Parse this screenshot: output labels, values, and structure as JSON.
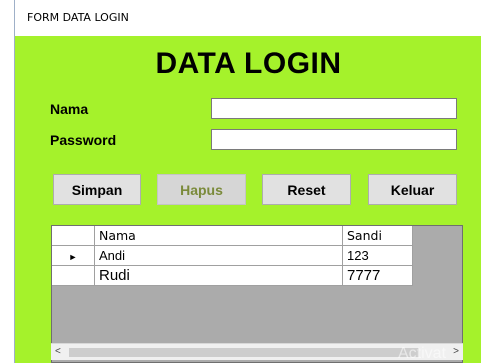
{
  "window": {
    "title": "FORM DATA LOGIN"
  },
  "form": {
    "heading": "DATA LOGIN",
    "nama_label": "Nama",
    "nama_value": "",
    "password_label": "Password",
    "password_value": ""
  },
  "buttons": {
    "simpan": "Simpan",
    "hapus": "Hapus",
    "reset": "Reset",
    "keluar": "Keluar"
  },
  "grid": {
    "columns": [
      "Nama",
      "Sandi"
    ],
    "rows": [
      {
        "indicator": "►",
        "nama": "Andi",
        "sandi": "123"
      },
      {
        "indicator": "",
        "nama": "Rudi",
        "sandi": "7777"
      }
    ]
  },
  "scrollbar": {
    "left_arrow": "<",
    "right_arrow": ">"
  },
  "watermark": "Activat",
  "colors": {
    "form_background": "#a5f22b",
    "grid_background": "#ababab"
  }
}
